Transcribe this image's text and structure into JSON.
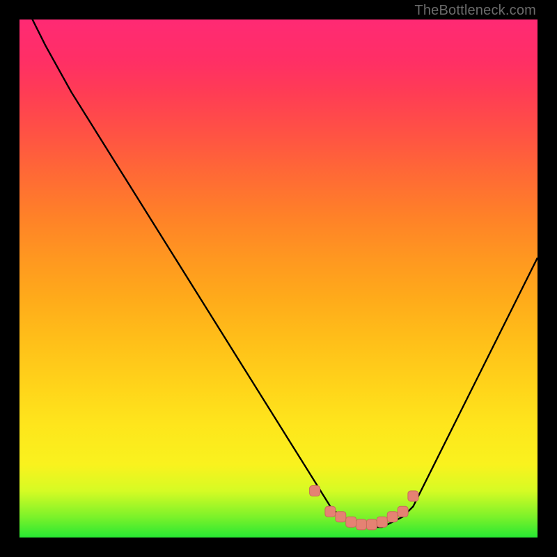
{
  "watermark": {
    "text": "TheBottleneck.com"
  },
  "chart_data": {
    "type": "line",
    "title": "",
    "xlabel": "",
    "ylabel": "",
    "xlim": [
      0,
      100
    ],
    "ylim": [
      0,
      100
    ],
    "x": [
      0,
      5,
      10,
      15,
      20,
      25,
      30,
      35,
      40,
      45,
      50,
      55,
      60,
      62,
      64,
      66,
      68,
      70,
      72,
      74,
      76,
      80,
      85,
      90,
      95,
      100
    ],
    "values": [
      105,
      95,
      86,
      78,
      70,
      62,
      54,
      46,
      38,
      30,
      22,
      14,
      6,
      4,
      3,
      2,
      2,
      2,
      3,
      4,
      6,
      14,
      24,
      34,
      44,
      54
    ],
    "series": [
      {
        "name": "markers",
        "x": [
          57,
          60,
          62,
          64,
          66,
          68,
          70,
          72,
          74,
          76
        ],
        "values": [
          9,
          5,
          4,
          3,
          2.5,
          2.5,
          3,
          4,
          5,
          8
        ]
      }
    ],
    "gradient_stops": [
      {
        "pct": 0,
        "color": "#27e833"
      },
      {
        "pct": 4,
        "color": "#7cf22a"
      },
      {
        "pct": 9,
        "color": "#d6fb24"
      },
      {
        "pct": 14,
        "color": "#f9f21e"
      },
      {
        "pct": 22,
        "color": "#fee51c"
      },
      {
        "pct": 30,
        "color": "#ffd21a"
      },
      {
        "pct": 38,
        "color": "#ffbf19"
      },
      {
        "pct": 46,
        "color": "#ffab1a"
      },
      {
        "pct": 54,
        "color": "#ff9720"
      },
      {
        "pct": 62,
        "color": "#ff8128"
      },
      {
        "pct": 70,
        "color": "#ff6a35"
      },
      {
        "pct": 78,
        "color": "#ff5244"
      },
      {
        "pct": 86,
        "color": "#ff3c55"
      },
      {
        "pct": 92,
        "color": "#ff2f65"
      },
      {
        "pct": 100,
        "color": "#ff2a74"
      }
    ],
    "colors": {
      "curve": "#000000",
      "marker_fill": "#e58273",
      "marker_stroke": "#c96a5c",
      "background_frame": "#000000"
    }
  }
}
